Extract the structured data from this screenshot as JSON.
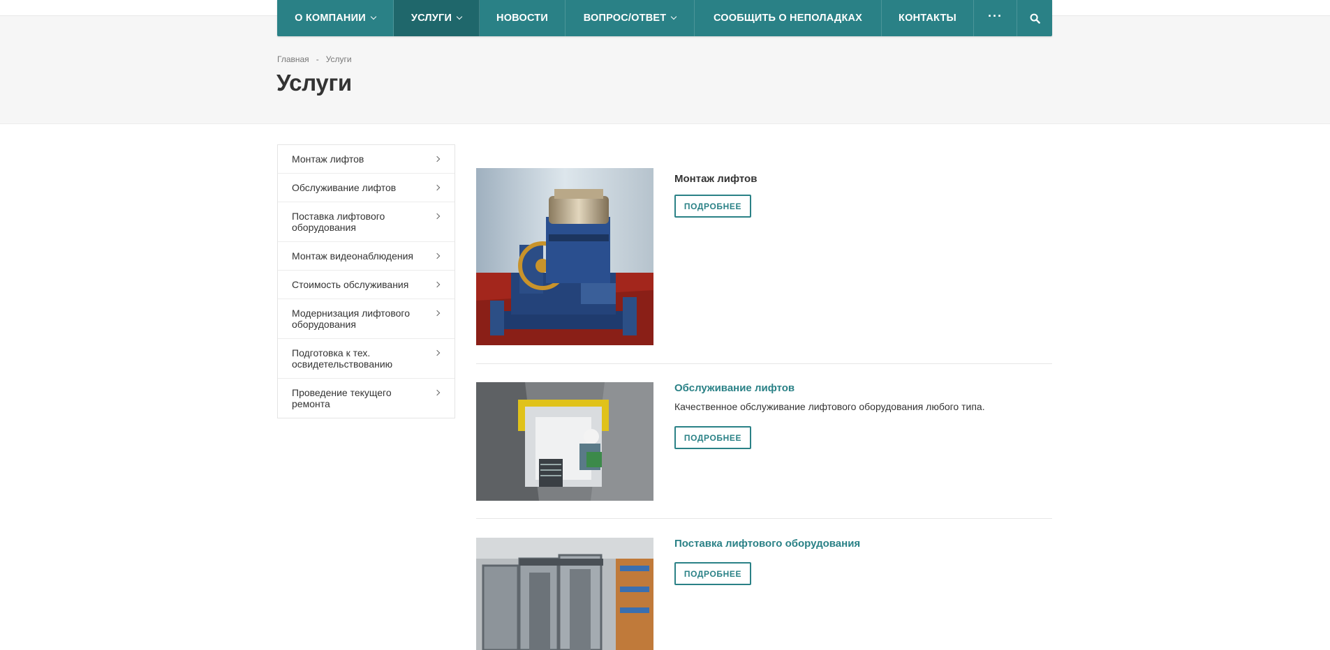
{
  "nav": {
    "items": [
      {
        "label": "О КОМПАНИИ",
        "dropdown": true
      },
      {
        "label": "УСЛУГИ",
        "dropdown": true,
        "active": true
      },
      {
        "label": "НОВОСТИ",
        "dropdown": false
      },
      {
        "label": "ВОПРОС/ОТВЕТ",
        "dropdown": true
      },
      {
        "label": "СООБЩИТЬ О НЕПОЛАДКАХ",
        "dropdown": false
      },
      {
        "label": "КОНТАКТЫ",
        "dropdown": false
      }
    ],
    "more_label": "···",
    "search_icon": "search-icon",
    "accent_color": "#2a8186"
  },
  "breadcrumb": {
    "home": "Главная",
    "separator": "-",
    "current": "Услуги"
  },
  "page_title": "Услуги",
  "sidebar": {
    "items": [
      "Монтаж лифтов",
      "Обслуживание лифтов",
      "Поставка лифтового оборудования",
      "Монтаж видеонаблюдения",
      "Стоимость обслуживания",
      "Модернизация лифтового оборудования",
      "Подготовка к тех. освидетельствованию",
      "Проведение текущего ремонта"
    ]
  },
  "services": [
    {
      "title": "Монтаж лифтов",
      "description": "",
      "button": "ПОДРОБНЕЕ"
    },
    {
      "title": "Обслуживание лифтов",
      "description": "Качественное обслуживание лифтового оборудования любого типа.",
      "button": "ПОДРОБНЕЕ"
    },
    {
      "title": "Поставка лифтового оборудования",
      "description": "",
      "button": "ПОДРОБНЕЕ"
    }
  ]
}
